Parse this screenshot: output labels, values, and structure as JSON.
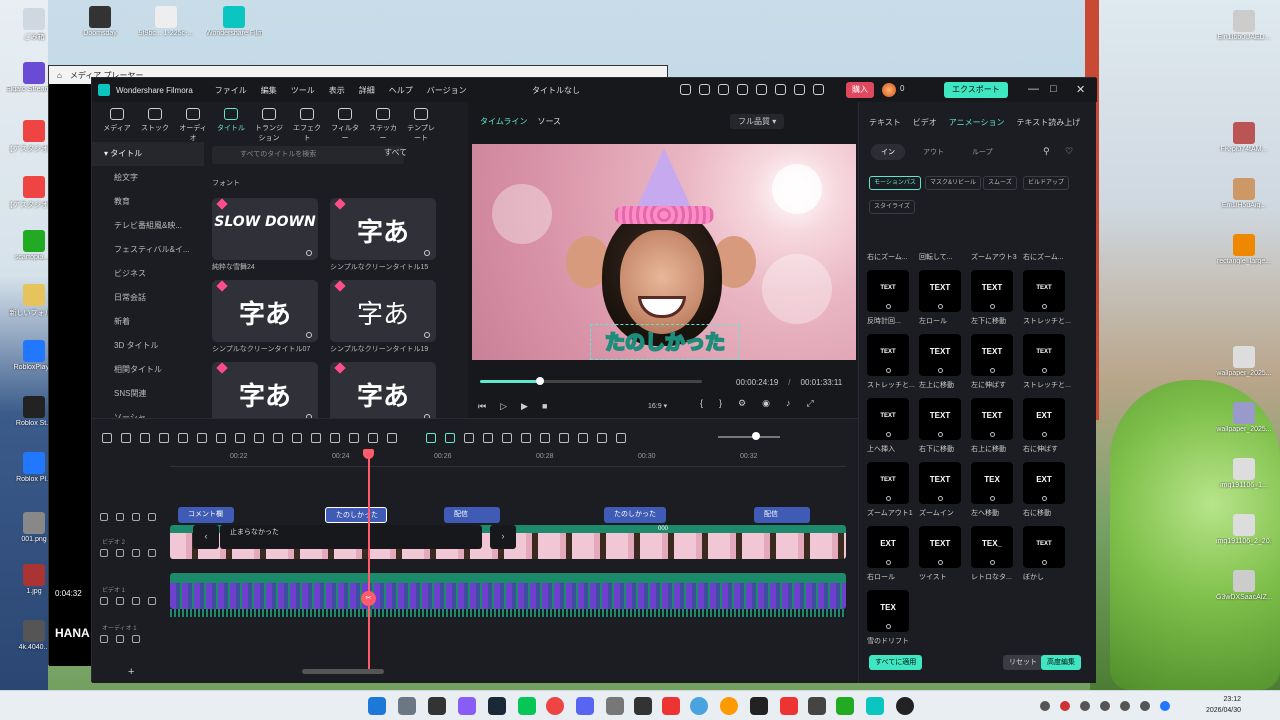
{
  "desktop": {
    "icons_left": [
      {
        "label": "ごみ箱"
      },
      {
        "label": "Elgato Stream Deck"
      },
      {
        "label": "【アスタジオ】KADOKAWA"
      },
      {
        "label": "【アスタジオ】3月ロ ード..."
      },
      {
        "label": "scartopia_..."
      },
      {
        "label": "新しいフォルダ"
      },
      {
        "label": "RobloxPlay..."
      },
      {
        "label": "Roblox St..."
      },
      {
        "label": "Roblox Pl..."
      },
      {
        "label": "001.png"
      },
      {
        "label": "1.jpg"
      },
      {
        "label": "4k.4040..."
      }
    ],
    "icons_top": [
      {
        "label": "Doomsday"
      },
      {
        "label": "9f9bc... 1-225c-..."
      },
      {
        "label": "Wondershare Filmora 15"
      }
    ],
    "icons_right": [
      {
        "label": "Eln1Ibb0UAED..."
      },
      {
        "label": "FK-pl074tAM..."
      },
      {
        "label": "Eni1lH5uAig..."
      },
      {
        "label": "rectangle_large..."
      },
      {
        "label": "wallpaper_2025..."
      },
      {
        "label": "wallpaper_2025..."
      },
      {
        "label": "img191106_1..."
      },
      {
        "label": "img191106_2_20..."
      },
      {
        "label": "G3wDXSaacAIZ..."
      }
    ]
  },
  "media_player": {
    "title": "メディア プレーヤー",
    "time": "0:04:32",
    "overlay_text": "HANA"
  },
  "app": {
    "name": "Wondershare Filmora",
    "menu": [
      "ファイル",
      "編集",
      "ツール",
      "表示",
      "詳細",
      "ヘルプ",
      "バージョン"
    ],
    "document_title": "タイトルなし",
    "buy_label": "購入",
    "credits": "0",
    "export_label": "エクスポート"
  },
  "toolbar": {
    "items": [
      {
        "label": "メディア",
        "icon": "media-icon"
      },
      {
        "label": "ストック",
        "icon": "stock-icon"
      },
      {
        "label": "オーディオ",
        "icon": "audio-icon"
      },
      {
        "label": "タイトル",
        "icon": "title-icon"
      },
      {
        "label": "トランジション",
        "icon": "transition-icon"
      },
      {
        "label": "エフェクト",
        "icon": "effect-icon"
      },
      {
        "label": "フィルター",
        "icon": "filter-icon"
      },
      {
        "label": "ステッカー",
        "icon": "sticker-icon"
      },
      {
        "label": "テンプレート",
        "icon": "template-icon"
      }
    ]
  },
  "categories": {
    "header": "タイトル",
    "items": [
      "絵文字",
      "教育",
      "テレビ番組風&映...",
      "フェスティバル&イ...",
      "ビジネス",
      "日常会話",
      "新着",
      "3D タイトル",
      "相関タイトル",
      "SNS関連",
      "ソーシャ..."
    ]
  },
  "titles": {
    "search_placeholder": "すべてのタイトルを検索",
    "filter_label": "すべて",
    "section": "フォント",
    "tiles": [
      {
        "glyph": "SLOW DOWN",
        "label": "純粋な雪舞24"
      },
      {
        "glyph": "字あ",
        "label": "シンプルなクリーンタイトル15"
      },
      {
        "glyph": "字あ",
        "label": "シンプルなクリーンタイトル07"
      },
      {
        "glyph": "字あ",
        "label": "シンプルなクリーンタイトル19"
      },
      {
        "glyph": "字あ",
        "label": ""
      },
      {
        "glyph": "字あ",
        "label": ""
      }
    ]
  },
  "preview": {
    "tabs": [
      "タイムライン",
      "ソース"
    ],
    "quality": "フル品質",
    "caption": "たのしかった",
    "current_time": "00:00:24:19",
    "total_time": "00:01:33:11",
    "ratio": "16:9",
    "progress": 0.27
  },
  "right_panel": {
    "tabs": [
      "テキスト",
      "ビデオ",
      "アニメーション",
      "テキスト読み上げ"
    ],
    "subtabs": [
      "イン",
      "アウト",
      "ループ"
    ],
    "chips": [
      "モーションパス",
      "マスク&リビール",
      "スムーズ",
      "ビルドアップ",
      "スタイライズ"
    ],
    "partial_labels": [
      "右にズーム...",
      "回転して...",
      "ズームアウト3",
      "右にズーム..."
    ],
    "animations": [
      {
        "preview": "TEXT",
        "label": "反時計回..."
      },
      {
        "preview": "TEXT",
        "label": "左ロール"
      },
      {
        "preview": "TEXT",
        "label": "左下に移動"
      },
      {
        "preview": "TEXT",
        "label": "ストレッチと..."
      },
      {
        "preview": "TEXT",
        "label": "ストレッチと..."
      },
      {
        "preview": "TEXT",
        "label": "左上に移動"
      },
      {
        "preview": "TEXT",
        "label": "左に伸ばす"
      },
      {
        "preview": "TEXT",
        "label": "ストレッチと..."
      },
      {
        "preview": "TEXT",
        "label": "上へ挿入"
      },
      {
        "preview": "TEXT",
        "label": "右下に移動"
      },
      {
        "preview": "TEXT",
        "label": "右上に移動"
      },
      {
        "preview": "EXT",
        "label": "右に伸ばす"
      },
      {
        "preview": "TEXT",
        "label": "ズームアウト1"
      },
      {
        "preview": "TEXT",
        "label": "ズームイン"
      },
      {
        "preview": "TEX",
        "label": "左へ移動"
      },
      {
        "preview": "EXT",
        "label": "右に移動"
      },
      {
        "preview": "EXT",
        "label": "右ロール"
      },
      {
        "preview": "TEXT",
        "label": "ツイスト"
      },
      {
        "preview": "TEX_",
        "label": "レトロなタ..."
      },
      {
        "preview": "TEXT",
        "label": "ぼかし"
      },
      {
        "preview": "TEX",
        "label": "雪のドリフト"
      }
    ],
    "apply_all": "すべてに適用",
    "reset": "リセット",
    "advanced": "高度編集"
  },
  "timeline": {
    "ruler": [
      "00:22",
      "00:24",
      "00:26",
      "00:28",
      "00:30",
      "00:32"
    ],
    "tracks": [
      "ビデオ 2",
      "ビデオ 1",
      "オーディオ 1"
    ],
    "title_clips": [
      "コメント欄",
      "たのしかった",
      "配信",
      "たのしかった",
      "配信"
    ],
    "gap_text": "止まらなかった",
    "clip_tag": "000"
  },
  "taskbar": {
    "time": "23:12",
    "date": "2026/04/30"
  }
}
